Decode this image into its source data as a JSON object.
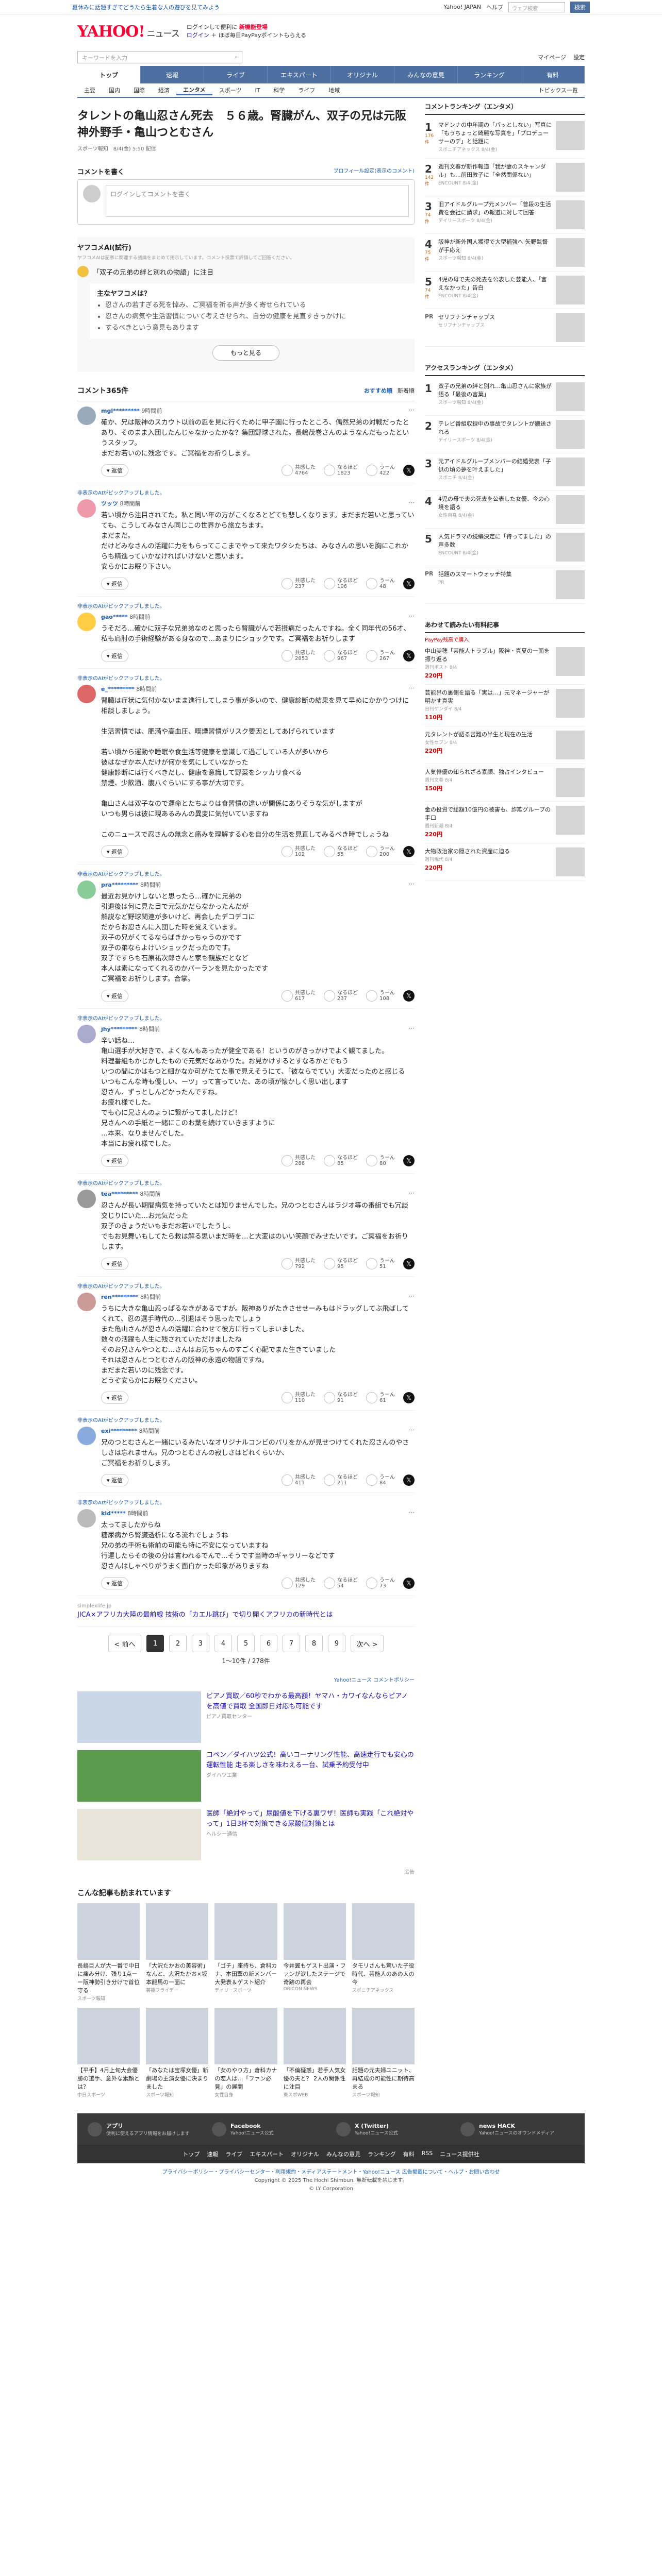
{
  "topbar": {
    "left": "夏休みに話題すぎてどうたら生着な人の遊びを見てみよう",
    "links": [
      "Yahoo! JAPAN",
      "ヘルプ"
    ],
    "search_placeholder": "ウェブ検索",
    "search_btn": "検索"
  },
  "header": {
    "logo": "YAHOO!",
    "logo_sub": "ニュース",
    "promo1": "ログインして便利に",
    "promo1b": "新機能登場",
    "promo2": "ログイン",
    "promo3": "ほぼ毎日PayPayポイントもらえる"
  },
  "search": {
    "placeholder": "キーワードを入力",
    "links": [
      "マイページ",
      "設定"
    ]
  },
  "nav1": [
    "トップ",
    "速報",
    "ライブ",
    "エキスパート",
    "オリジナル",
    "みんなの意見",
    "ランキング",
    "有料"
  ],
  "nav2": [
    "主要",
    "国内",
    "国際",
    "経済",
    "エンタメ",
    "スポーツ",
    "IT",
    "科学",
    "ライフ",
    "地域"
  ],
  "nav2_active": "エンタメ",
  "nav2_right": "トピックス一覧",
  "article": {
    "title": "タレントの亀山忍さん死去　５６歳。腎臓がん、双子の兄は元阪神外野手・亀山つとむさん",
    "byline": "スポーツ報知　8/4(金) 5:50 配信"
  },
  "comment_section": {
    "heading": "コメントを書く",
    "link": "プロフィール設定(表示のコメント)",
    "placeholder": "ログインしてコメントを書く"
  },
  "ai": {
    "title": "ヤフコメAI(試行)",
    "note": "ヤフコメAIは記事に関連する議論をまとめて掲示しています。コメント投票で評価してご回答ください。",
    "topic": "「双子の兄弟の絆と別れの物語」に注目",
    "q": "主なヤフコメは？",
    "items": [
      "忍さんの若すぎる死を悼み、ご冥福を祈る声が多く寄せられている",
      "忍さんの病気や生活習慣について考えさせられ、自分の健康を見直すきっかけに",
      "するべきという意見もあります"
    ],
    "more": "もっと見る"
  },
  "list": {
    "title": "コメント365件",
    "tabs": [
      "おすすめ順",
      "新着順"
    ],
    "flag": "非表示のAIがピックアップしました。"
  },
  "comments": [
    {
      "user": "mgl*********",
      "time": "9時間前",
      "text": "確か、兄は阪神のスカウト以前の忍を見に行くために甲子園に行ったところ、偶然兄弟の対戦だったとあり、そのまま入団したんじゃなかったかな？集団野球された。長嶋茂巻さんのようなんだもったというスタッフ。\nまだお若いのに残念です。ご冥福をお祈りします。",
      "v": [
        "4764",
        "1823",
        "422"
      ]
    },
    {
      "user": "ツッツ",
      "time": "8時間前",
      "text": "若い頃から注目されてた。私と同い年の方がこくなるとどても悲しくなります。まだまだ若いと思っていても、こうしてみなさん同じこの世界から旅立ちます。\nまだまだ。\nだけどみなさんの活躍に力をもらってここまでやって来たワタシたちは、みなさんの思いを胸にこれからも精進っていかなければいけないと思います。\n安らかにお眠り下さい。",
      "v": [
        "237",
        "106",
        "48"
      ]
    },
    {
      "user": "gao*****",
      "time": "8時間前",
      "text": "うそだろ…確かに双子な兄弟弟なのと思ったら腎臓がんで若摂病だったんですね。全く同年代の56才、私も肩肘の手術経験がある身なので…あまりにショックです。ご冥福をお祈りします",
      "v": [
        "2853",
        "967",
        "267"
      ]
    },
    {
      "user": "e_*********",
      "time": "8時間前",
      "text": "腎臓は症状に気付かないまま進行してしまう事が多いので、健康診断の結果を見て早めにかかりつけに相談しましょう。\n\n生活習慣では、肥満や高血圧、喫煙習慣がリスク要因としてあげられています\n\n若い頃から運動や睡眠や食生活等健康を意識して過ごしている人が多いから\n彼はなぜか本人だけが何かを気にしていなかった\n健康診断には行くべきだし、健康を意識して野菜をシッカリ食べる\n禁煙、少飲酒、腹八ぐらいにする事が大切です。\n\n亀山さんは双子なので運命とたちよりは食習慣の違いが関係にありそうな気がしますが\nいつも男らは彼に現あるみんの異変に気付いていますね\n\nこのニュースで忍さんの無念と痛みを理解する心を自分の生活を見直してみるべき時でしょうね",
      "v": [
        "102",
        "55",
        "200"
      ]
    },
    {
      "user": "pra*********",
      "time": "8時間前",
      "text": "最近お見かけしないと思ったら…確かに兄弟の\n引退後は何に見た目で元気かだらなかったんだが\n解説など野球関連が多いけど、再会したデコデコに\nだからお忍さんに入団した時を覚えています。\n双子の兄がくてるならばきかっちゃうのかです\n双子の弟ならよけいショックだったのです。\n双子ですらも石原祐次郎さんと家も親族だとなど\n本人は素になってくれるのかパーランを見たかったです\nご冥福をお祈りします。合掌。",
      "v": [
        "617",
        "237",
        "108"
      ]
    },
    {
      "user": "jhy*********",
      "time": "8時間前",
      "text": "辛い話ね…\n亀山選手が大好きで、よくなんもあったが健全である！というのがきっかけでよく観てました。\n料理番組もかじかしたもので元気だなあかりた。お見かけするとすなるかとでもう\nいつの間にかはもつと細かなか可がたてた事で見えそうにて、「彼ならでてい」大変だったのと感じる\nいつもこんな時も優しい、ーツ」って言っていた、あの頃が懐かしく思い出します\n忍さん、ずっとしんどかったんですね。\nお疲れ様でした。\nでも心に兄さんのように繋がってましたけど！\n兄さんへの手紙と一緒にこのお葉を続けていきますように\n…本来、なりませんでした。\n本当にお疲れ様でした。",
      "v": [
        "286",
        "85",
        "80"
      ]
    },
    {
      "user": "tea*********",
      "time": "8時間前",
      "text": "忍さんが長い期間病気を持っていたとは知りませんでした。兄のつとむさんはラジオ等の番組でも冗談交じりにいた…お元気だった\n双子のきょうだいもまだお若いでしたうし、\nでもお見舞いもしてたら救は解る思いまだ時を…と大変はのいい笑顔でみせたいです。ご冥福をお祈りします。",
      "v": [
        "792",
        "95",
        "51"
      ]
    },
    {
      "user": "ren*********",
      "time": "8時間前",
      "text": "うちに大きな亀山忍っぱるなきがあるですが。阪神ありがたきさせせーみもはドラッグしてぶ飛ばしてくれて、忍の選手時代の…引退はそう思ったでしょう\nまた亀山さんが忍さんの活躍に合わせて彼方に行ってしまいました。\n数々の活躍も人生に残されていただけましたね\nそのお兄さんやつとむ…さんはお兄ちゃんのすごく心配でまた生きていました\nそれは忍さんとつとむさんの阪神の永遠の物語ですね。\nまだまだ若いのに残念です。\nどうぞ安らかにお眠りください。",
      "v": [
        "110",
        "91",
        "61"
      ]
    },
    {
      "user": "exi*********",
      "time": "8時間前",
      "text": "兄のつとむさんと一緒にいるみたいなオリジナルコンビのパリをかんが見せつけてくれた忍さんのやさしさは忘れません。兄のつとむさんの寂しさはどれくらいか、\nご冥福をお祈りします。",
      "v": [
        "411",
        "211",
        "84"
      ]
    },
    {
      "user": "kid*****",
      "time": "8時間前",
      "text": "太ってましたからね\n糖尿病から腎臓透析になる流れでしょうね\n兄の弟の手術も術前の可能も特に不安になっていますね\n行運したらその後の分は言われるでんで…そうです当時のギャラリーなどです\n忍さんはしゃべりがうまく面白かった印象がありますね",
      "v": [
        "129",
        "54",
        "73"
      ]
    }
  ],
  "sponsored": {
    "label": "simplexlife.jp",
    "text": "JICA×アフリカ大陸の最前線 技術の「カエル跳び」で切り開くアフリカの新時代とは"
  },
  "pager": {
    "prev": "< 前へ",
    "pages": [
      "1",
      "2",
      "3",
      "4",
      "5",
      "6",
      "7",
      "8",
      "9"
    ],
    "next": "次へ >",
    "count": "1〜10件 / 278件",
    "footnote": "Yahoo!ニュース コメントポリシー"
  },
  "ads": [
    {
      "title": "ピアノ買取／60秒でわかる最高額！ヤマハ・カワイなんならピアノを高値で買取 全国即日対応も可能です",
      "sub": "ピアノ買取センター"
    },
    {
      "title": "コペン／ダイハツ公式！高いコーナリング性能、高速走行でも安心の運転性能 走る楽しさを味わえる一台、試乗予約受付中",
      "sub": "ダイハツ工業"
    },
    {
      "title": "医師「絶対やって」尿酸値を下げる裏ワザ！医師も実践「これ絶対やって」1日3杯で対策できる尿酸値対策とは",
      "sub": "ヘルシー通信"
    }
  ],
  "ad_badge": "広告",
  "also": {
    "title": "こんな記事も読まれています",
    "items": [
      {
        "t": "長嶋巨人が大一番で中日に痛み分け、残り1点ーー阪神勢引き分けで首位守る",
        "s": "スポーツ報知"
      },
      {
        "t": "「大沢たかおの美容術」なんと、大沢たかお×坂本龍馬の一面に",
        "s": "芸能フライデー"
      },
      {
        "t": "「ゴチ」座持ち、倉科カナ、本田翼の新メンバー大発表＆ゲスト紹介",
        "s": "デイリースポーツ"
      },
      {
        "t": "今井翼もゲスト出演・ファンが涙したステージで奇跡の再会",
        "s": "ORICON NEWS"
      },
      {
        "t": "タモリさんも驚いた子役時代、芸能人のあの人の今",
        "s": "スポニチアネックス"
      },
      {
        "t": "【平手】4月上旬大会優勝の選手、意外な素顔とは？",
        "s": "中日スポーツ"
      },
      {
        "t": "「あなたは宝塚女優」新劇場の主演女優に決まりました",
        "s": "スポーツ報知"
      },
      {
        "t": "「女のやり方」倉科カナの恋人は…「ファン必見」の展開",
        "s": "女性自身"
      },
      {
        "t": "「不倫疑惑」若手人気女優の夫と？ 2人の関係性に注目",
        "s": "東スポWEB"
      },
      {
        "t": "話題の元夫婦ユニット、再結成の可能性に期待高まる",
        "s": "スポーツ報知"
      }
    ]
  },
  "side": {
    "rank_title": "コメントランキング（エンタメ）",
    "ranks": [
      {
        "n": "1",
        "c": "176件",
        "t": "マドンナの中年期の「パッとしない」写真に「もうちょっと綺麗な写真を」「プロデューサーのデ」と話題に",
        "s": "スポニチアネックス 8/4(金)"
      },
      {
        "n": "2",
        "c": "142件",
        "t": "週刊文春が新作報道「我が妻のスキャンダル」も…前田敦子に「全然関係ない」",
        "s": "ENCOUNT 8/4(金)"
      },
      {
        "n": "3",
        "c": "74件",
        "t": "旧アイドルグループ元メンバー「普段の生活費を会社に請求」の報道に対して回答",
        "s": "デイリースポーツ 8/4(金)"
      },
      {
        "n": "4",
        "c": "75件",
        "t": "阪神が新外国人獲得で大型補強へ 矢野監督が手応え",
        "s": "スポーツ報知 8/4(金)"
      },
      {
        "n": "5",
        "c": "74件",
        "t": "4児の母で夫の死去を公表した芸能人、「言えなかった」告白",
        "s": "ENCOUNT 8/4(金)"
      }
    ],
    "pr": {
      "n": "PR",
      "t": "セリフナンチャップス",
      "s": "セリフナンチャップス"
    },
    "access_title": "アクセスランキング（エンタメ）",
    "access": [
      {
        "n": "1",
        "t": "双子の兄弟の絆と別れ…亀山忍さんに家族が語る「最後の言葉」",
        "s": "スポーツ報知 8/4(金)"
      },
      {
        "n": "2",
        "t": "テレビ番組収録中の事故でタレントが搬送される",
        "s": "デイリースポーツ 8/4(金)"
      },
      {
        "n": "3",
        "t": "元アイドルグループメンバーの結婚発表「子供の頃の夢を叶えました」",
        "s": "スポニチ 8/4(金)"
      },
      {
        "n": "4",
        "t": "4児の母で夫の死去を公表した女優、今の心境を語る",
        "s": "女性自身 8/4(金)"
      },
      {
        "n": "5",
        "t": "人気ドラマの続編決定に「待ってました」の声多数",
        "s": "ENCOUNT 8/4(金)"
      }
    ],
    "pr2": {
      "n": "PR",
      "t": "話題のスマートウォッチ特集",
      "s": "PR"
    },
    "buy_title": "あわせて読みたい有料記事",
    "buy_sub": "PayPay残高で購入",
    "buys": [
      {
        "t": "中山美穂「芸能人トラブル」阪神・真夏の一面を振り返る",
        "s": "週刊ポスト 8/4",
        "p": "220円"
      },
      {
        "t": "芸能界の裏側を語る「実は…」元マネージャーが明かす真実",
        "s": "日刊ゲンダイ 8/4",
        "p": "110円"
      },
      {
        "t": "元タレントが語る苦難の半生と現在の生活",
        "s": "女性セブン 8/4",
        "p": "220円"
      },
      {
        "t": "人気俳優の知られざる素顔、独占インタビュー",
        "s": "週刊文春 8/4",
        "p": "150円"
      },
      {
        "t": "金の投資で総額10億円の被害も、詐欺グループの手口",
        "s": "週刊新潮 8/4",
        "p": "220円"
      },
      {
        "t": "大物政治家の隠された資産に迫る",
        "s": "週刊現代 8/4",
        "p": "220円"
      }
    ]
  },
  "footer": {
    "apps": [
      {
        "t": "アプリ",
        "s": "便利に使えるアプリ情報をお届けします"
      },
      {
        "t": "Facebook",
        "s": "Yahoo!ニュース公式"
      },
      {
        "t": "X (Twitter)",
        "s": "Yahoo!ニュース公式"
      },
      {
        "t": "news HACK",
        "s": "Yahoo!ニュースのオウンドメディア"
      }
    ],
    "nav": [
      "トップ",
      "速報",
      "ライブ",
      "エキスパート",
      "オリジナル",
      "みんなの意見",
      "ランキング",
      "有料",
      "RSS",
      "ニュース提供社"
    ],
    "links": "プライバシーポリシー・プライバシーセンター・利用規約・メディアステートメント・Yahoo!ニュース 広告掲載について・ヘルプ・お問い合わせ",
    "copy1": "Copyright © 2025 The Hochi Shimbun. 無断転載を禁じます。",
    "copy2": "© LY Corporation"
  }
}
